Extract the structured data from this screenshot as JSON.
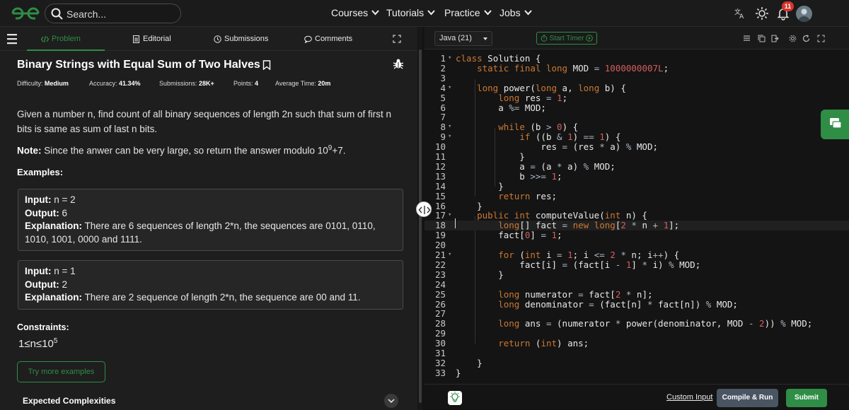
{
  "nav": {
    "search_placeholder": "Search...",
    "links": [
      "Courses",
      "Tutorials",
      "Practice",
      "Jobs"
    ],
    "notification_count": "11",
    "brand_color": "#2f8d46"
  },
  "tabs": {
    "problem": "Problem",
    "editorial": "Editorial",
    "submissions": "Submissions",
    "comments": "Comments"
  },
  "problem": {
    "title": "Binary Strings with Equal Sum of Two Halves",
    "difficulty_label": "Difficulty:",
    "difficulty": "Medium",
    "accuracy_label": "Accuracy:",
    "accuracy": "41.34%",
    "submissions_label": "Submissions:",
    "submissions": "28K+",
    "points_label": "Points:",
    "points": "4",
    "avg_time_label": "Average Time:",
    "avg_time": "20m",
    "statement": "Given a number n, find count of all binary sequences of length 2n such that sum of first n bits is same as sum of last n bits.",
    "note_label": "Note:",
    "note_text": "Since the anwer can be very large, so return the answer modulo 10",
    "note_exp": "9",
    "note_tail": "+7.",
    "examples_heading": "Examples:",
    "examples": [
      {
        "input_label": "Input:",
        "input": "n = 2",
        "output_label": "Output:",
        "output": "6",
        "explanation_label": "Explanation:",
        "explanation": "There are 6 sequences of length 2*n, the sequences are 0101, 0110, 1010, 1001, 0000 and 1111."
      },
      {
        "input_label": "Input:",
        "input": "n = 1",
        "output_label": "Output:",
        "output": "2",
        "explanation_label": "Explanation:",
        "explanation": "There are 2 sequence of length 2*n, the sequence are 00 and 11."
      }
    ],
    "constraints_heading": "Constraints:",
    "constraint_text": "1≤n≤10",
    "constraint_exp": "5",
    "try_more": "Try more examples",
    "expected_heading": "Expected Complexities"
  },
  "editor": {
    "language": "Java (21)",
    "start_timer": "Start Timer",
    "custom_input": "Custom Input",
    "compile_run": "Compile & Run",
    "submit": "Submit",
    "code": [
      "class Solution {",
      "    static final long MOD = 1000000007L;",
      "",
      "    long power(long a, long b) {",
      "        long res = 1;",
      "        a %= MOD;",
      "",
      "        while (b > 0) {",
      "            if ((b & 1) == 1) {",
      "                res = (res * a) % MOD;",
      "            }",
      "            a = (a * a) % MOD;",
      "            b >>= 1;",
      "        }",
      "        return res;",
      "    }",
      "    public int computeValue(int n) {",
      "        long[] fact = new long[2 * n + 1];",
      "        fact[0] = 1;",
      "",
      "        for (int i = 1; i <= 2 * n; i++) {",
      "            fact[i] = (fact[i - 1] * i) % MOD;",
      "        }",
      "",
      "        long numerator = fact[2 * n];",
      "        long denominator = (fact[n] * fact[n]) % MOD;",
      "",
      "        long ans = (numerator * power(denominator, MOD - 2)) % MOD;",
      "",
      "        return (int) ans;",
      "",
      "    }",
      "}"
    ],
    "fold_lines": [
      1,
      4,
      8,
      9,
      17,
      21
    ]
  }
}
